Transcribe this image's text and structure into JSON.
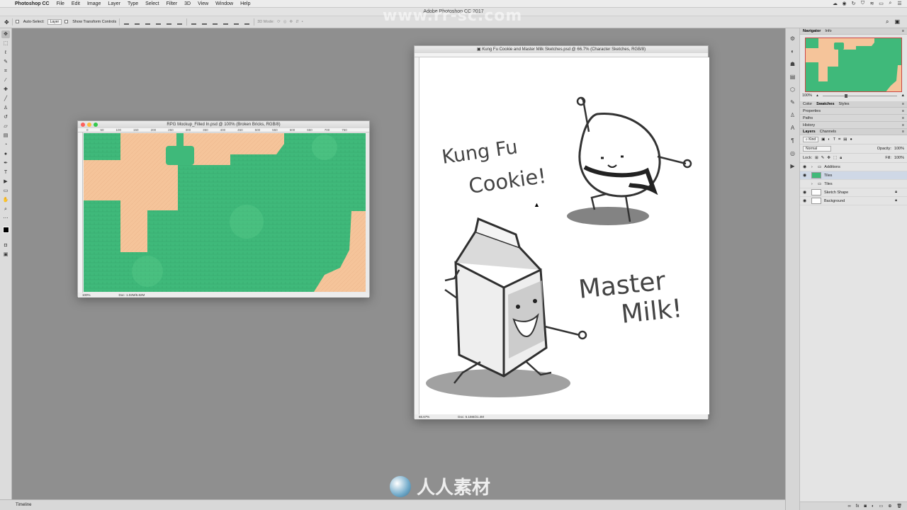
{
  "menubar": {
    "app_name": "Photoshop CC",
    "items": [
      "File",
      "Edit",
      "Image",
      "Layer",
      "Type",
      "Select",
      "Filter",
      "3D",
      "View",
      "Window",
      "Help"
    ]
  },
  "titlebar": {
    "title": "Adobe Photoshop CC 2017"
  },
  "options": {
    "auto_select_label": "Auto-Select:",
    "auto_select_value": "Layer",
    "transform_label": "Show Transform Controls",
    "mode_3d_label": "3D Mode:"
  },
  "tools": [
    "move",
    "marquee",
    "lasso",
    "quick-select",
    "crop",
    "eyedropper",
    "healing",
    "brush",
    "stamp",
    "history-brush",
    "eraser",
    "gradient",
    "blur",
    "dodge",
    "pen",
    "type",
    "path-select",
    "shape",
    "hand",
    "zoom",
    "more"
  ],
  "documents": {
    "rpg": {
      "title": "RPG Mockup_Filled In.psd @ 100% (Broken Bricks, RGB/8)",
      "zoom": "100%",
      "doc_size": "Doc: 1.02M/6.82M",
      "ruler_ticks": [
        "0",
        "50",
        "100",
        "150",
        "200",
        "250",
        "300",
        "350",
        "400",
        "450",
        "500",
        "550",
        "600",
        "650",
        "700",
        "750"
      ]
    },
    "sketch": {
      "title": "Kung Fu Cookie and Master Milk Sketches.psd @ 66.7% (Character Sketches, RGB/8)",
      "zoom": "66.67%",
      "doc_size": "Doc: 5.15M/21.4M",
      "text_kungfu_line1": "Kung Fu",
      "text_kungfu_line2": "Cookie!",
      "text_master_line1": "Master",
      "text_master_line2": "Milk!"
    }
  },
  "panels": {
    "navigator_tabs": [
      "Navigator",
      "Info"
    ],
    "nav_zoom": "100%",
    "color_tabs": [
      "Color",
      "Swatches",
      "Styles"
    ],
    "collapsed": [
      "Properties",
      "Paths",
      "History"
    ],
    "layers_tabs": [
      "Layers",
      "Channels"
    ],
    "kind_label": "Kind",
    "blend_mode": "Normal",
    "opacity_label": "Opacity:",
    "opacity_value": "100%",
    "lock_label": "Lock:",
    "fill_label": "Fill:",
    "fill_value": "100%",
    "layers": [
      {
        "name": "Additions",
        "type": "group"
      },
      {
        "name": "Tiles",
        "type": "layer"
      },
      {
        "name": "Tiles",
        "type": "group"
      },
      {
        "name": "Sketch Shape",
        "type": "layer"
      },
      {
        "name": "Background",
        "type": "layer"
      }
    ]
  },
  "timeline": {
    "label": "Timeline"
  },
  "watermark": {
    "top": "www.rr-sc.com",
    "bottom": "人人素材"
  },
  "colors": {
    "grass": "#3fb97a",
    "dirt": "#f5c49a",
    "workspace": "#8f8f8f"
  }
}
